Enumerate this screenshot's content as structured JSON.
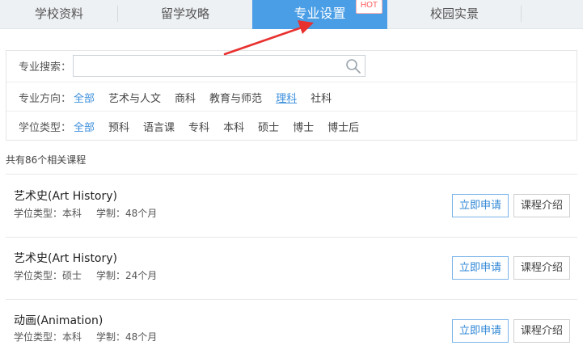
{
  "tabs": [
    {
      "label": "学校资料"
    },
    {
      "label": "留学攻略"
    },
    {
      "label": "专业设置",
      "badge": "HOT",
      "active": true
    },
    {
      "label": "校园实景"
    }
  ],
  "filters": {
    "search": {
      "label": "专业搜索：",
      "value": "",
      "placeholder": ""
    },
    "direction": {
      "label": "专业方向：",
      "options": [
        "全部",
        "艺术与人文",
        "商科",
        "教育与师范",
        "理科",
        "社科"
      ],
      "selected": "全部",
      "hovered": "理科"
    },
    "degree": {
      "label": "学位类型：",
      "options": [
        "全部",
        "预科",
        "语言课",
        "专科",
        "本科",
        "硕士",
        "博士",
        "博士后"
      ],
      "selected": "全部"
    }
  },
  "result_count": "共有86个相关课程",
  "courses": [
    {
      "title": "艺术史(Art History)",
      "degree": "学位类型：本科",
      "duration": "学制：48个月",
      "apply": "立即申请",
      "intro": "课程介绍"
    },
    {
      "title": "艺术史(Art History)",
      "degree": "学位类型：硕士",
      "duration": "学制：24个月",
      "apply": "立即申请",
      "intro": "课程介绍"
    },
    {
      "title": "动画(Animation)",
      "degree": "学位类型：本科",
      "duration": "学制：48个月",
      "apply": "立即申请",
      "intro": "课程介绍"
    }
  ],
  "colors": {
    "accent": "#4a9ee6",
    "link": "#3d8fdc",
    "hot": "#ff5a5a",
    "arrow": "#e8312f"
  }
}
